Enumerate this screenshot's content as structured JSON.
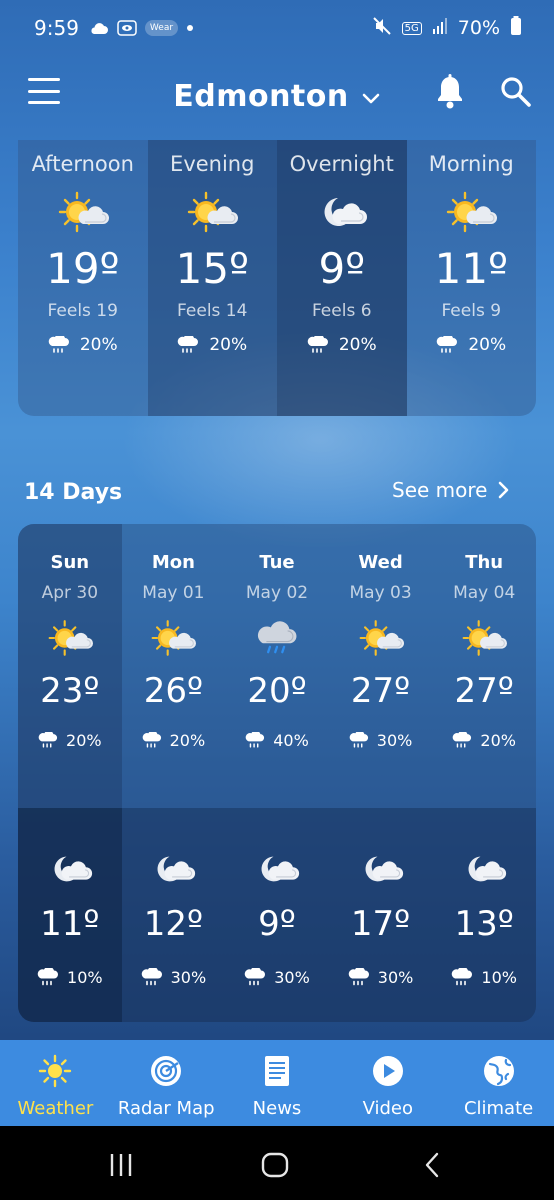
{
  "status_bar": {
    "time": "9:59",
    "wear_label": "Wear",
    "network": "5G",
    "battery": "70%"
  },
  "header": {
    "city": "Edmonton"
  },
  "hourly": [
    {
      "period": "Afternoon",
      "icon": "sun-cloud-icon",
      "temp": "19º",
      "feels": "Feels 19",
      "precip": "20%"
    },
    {
      "period": "Evening",
      "icon": "sun-cloud-icon",
      "temp": "15º",
      "feels": "Feels 14",
      "precip": "20%"
    },
    {
      "period": "Overnight",
      "icon": "moon-cloud-icon",
      "temp": "9º",
      "feels": "Feels 6",
      "precip": "20%"
    },
    {
      "period": "Morning",
      "icon": "sun-cloud-icon",
      "temp": "11º",
      "feels": "Feels 9",
      "precip": "20%"
    }
  ],
  "days_section": {
    "title": "14 Days",
    "see_more": "See more"
  },
  "days": [
    {
      "name": "Sun",
      "date": "Apr 30",
      "day_icon": "sun-cloud-icon",
      "high": "23º",
      "day_precip": "20%",
      "night_icon": "moon-cloud-icon",
      "low": "11º",
      "night_precip": "10%"
    },
    {
      "name": "Mon",
      "date": "May 01",
      "day_icon": "sun-cloud-icon",
      "high": "26º",
      "day_precip": "20%",
      "night_icon": "moon-cloud-icon",
      "low": "12º",
      "night_precip": "30%"
    },
    {
      "name": "Tue",
      "date": "May 02",
      "day_icon": "rain-cloud-icon",
      "high": "20º",
      "day_precip": "40%",
      "night_icon": "moon-cloud-icon",
      "low": "9º",
      "night_precip": "30%"
    },
    {
      "name": "Wed",
      "date": "May 03",
      "day_icon": "sun-cloud-icon",
      "high": "27º",
      "day_precip": "30%",
      "night_icon": "moon-cloud-icon",
      "low": "17º",
      "night_precip": "30%"
    },
    {
      "name": "Thu",
      "date": "May 04",
      "day_icon": "sun-cloud-icon",
      "high": "27º",
      "day_precip": "20%",
      "night_icon": "moon-cloud-icon",
      "low": "13º",
      "night_precip": "10%"
    }
  ],
  "bottom_nav": [
    {
      "label": "Weather",
      "icon": "sun-icon",
      "active": true
    },
    {
      "label": "Radar Map",
      "icon": "radar-icon",
      "active": false
    },
    {
      "label": "News",
      "icon": "news-icon",
      "active": false
    },
    {
      "label": "Video",
      "icon": "video-play-icon",
      "active": false
    },
    {
      "label": "Climate",
      "icon": "globe-icon",
      "active": false
    }
  ],
  "colors": {
    "active_nav": "#ffe14a",
    "nav_background": "#3d8be0",
    "sun": "#f6c12b"
  }
}
